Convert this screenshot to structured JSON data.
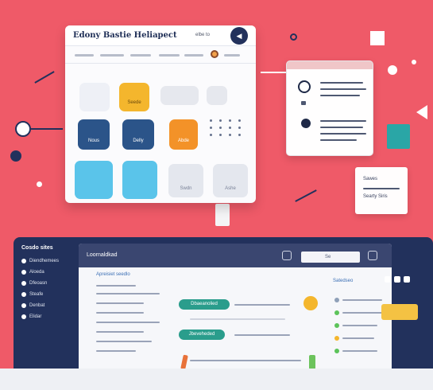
{
  "app": {
    "title": "Edony Bastie Heliapect"
  },
  "top_panel": {
    "header_small": "elbe to",
    "header_button": "◀",
    "tiles": [
      {
        "label": "",
        "color": "#eef0f6"
      },
      {
        "label": "Seede",
        "color": "#f4b62d"
      },
      {
        "label": "",
        "color": "#e6e8ee"
      },
      {
        "label": "",
        "color": "#e6e8ee"
      },
      {
        "label": "Nous",
        "color": "#2b5489"
      },
      {
        "label": "Delly",
        "color": "#2b5489"
      },
      {
        "label": "Abde",
        "color": "#f39228"
      },
      {
        "label": "",
        "color": "#5ac4ea"
      },
      {
        "label": "",
        "color": "#5ac4ea"
      },
      {
        "label": "Swdn",
        "color": "#e4e7ee"
      },
      {
        "label": "Ashe",
        "color": "#e4e7ee"
      }
    ]
  },
  "info_card": {
    "lines": [
      "",
      "",
      "",
      "",
      "",
      ""
    ]
  },
  "note_card": {
    "lines": [
      "Sawes",
      "Searty Siris"
    ]
  },
  "dashboard": {
    "sidebar": {
      "title": "Cosdo sites",
      "items": [
        "Diendhemees",
        "Aloeda",
        "Dfeoasn",
        "Steafe",
        "Denbat",
        "Elidar"
      ]
    },
    "header_title": "Loornaldkad",
    "search_value": "Se",
    "pills": [
      "Dbaeanolied",
      "Jbeveheded"
    ],
    "row_label": "Apreisiet seedlo",
    "widget_text": "Satedseo"
  },
  "colors": {
    "background": "#ef5a68",
    "navy": "#22315c",
    "accent": "#2a9d8c",
    "yellow": "#f4b62d"
  }
}
